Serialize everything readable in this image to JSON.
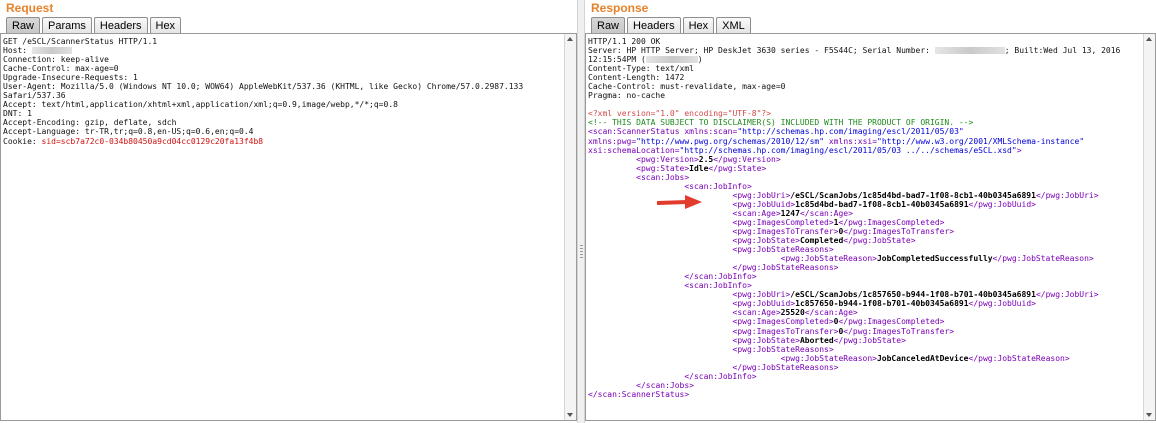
{
  "request": {
    "title": "Request",
    "tabs": [
      "Raw",
      "Params",
      "Headers",
      "Hex"
    ],
    "lines": [
      "GET /eSCL/ScannerStatus HTTP/1.1",
      "Host: ",
      "Connection: keep-alive",
      "Cache-Control: max-age=0",
      "Upgrade-Insecure-Requests: 1",
      "User-Agent: Mozilla/5.0 (Windows NT 10.0; WOW64) AppleWebKit/537.36 (KHTML, like Gecko) Chrome/57.0.2987.133",
      "Safari/537.36",
      "Accept: text/html,application/xhtml+xml,application/xml;q=0.9,image/webp,*/*;q=0.8",
      "DNT: 1",
      "Accept-Encoding: gzip, deflate, sdch",
      "Accept-Language: tr-TR,tr;q=0.8,en-US;q=0.6,en;q=0.4"
    ],
    "cookie_label": "Cookie: ",
    "cookie_name": "sid",
    "cookie_value": "=scb7a72c0-034b80450a9cd04cc0129c20fa13f4b8"
  },
  "response": {
    "title": "Response",
    "tabs": [
      "Raw",
      "Headers",
      "Hex",
      "XML"
    ],
    "status_line": "HTTP/1.1 200 OK",
    "server_prefix": "Server: HP HTTP Server; HP DeskJet 3630 series - F5S44C; Serial Number: ",
    "server_suffix": "; Built:Wed Jul 13, 2016",
    "built_time_prefix": "12:15:54PM (",
    "built_time_suffix": ")",
    "headers": [
      "Content-Type: text/xml",
      "Content-Length: 1472",
      "Cache-Control: must-revalidate, max-age=0",
      "Pragma: no-cache"
    ],
    "xml_decl": "<?xml version=\"1.0\" encoding=\"UTF-8\"?>",
    "xml_comment": "<!-- THIS DATA SUBJECT TO DISCLAIMER(S) INCLUDED WITH THE PRODUCT OF ORIGIN. -->",
    "ns_scan": "http://schemas.hp.com/imaging/escl/2011/05/03",
    "ns_pwg": "http://www.pwg.org/schemas/2010/12/sm",
    "ns_xsi": "http://www.w3.org/2001/XMLSchema-instance",
    "schema_location": "http://schemas.hp.com/imaging/escl/2011/05/03 ../../schemas/eSCL.xsd",
    "version": "2.5",
    "state": "Idle",
    "jobs": [
      {
        "uri": "/eSCL/ScanJobs/1c85d4bd-bad7-1f08-8cb1-40b0345a6891",
        "uuid": "1c85d4bd-bad7-1f08-8cb1-40b0345a6891",
        "age": "1247",
        "images_completed": "1",
        "images_to_transfer": "0",
        "job_state": "Completed",
        "job_state_reason": "JobCompletedSuccessfully"
      },
      {
        "uri": "/eSCL/ScanJobs/1c857650-b944-1f08-b701-40b0345a6891",
        "uuid": "1c857650-b944-1f08-b701-40b0345a6891",
        "age": "25520",
        "images_completed": "0",
        "images_to_transfer": "0",
        "job_state": "Aborted",
        "job_state_reason": "JobCanceledAtDevice"
      }
    ]
  },
  "colors": {
    "title_orange": "#e8822a",
    "xml_tag": "#7a00b6",
    "xml_attr_value": "#0000d8",
    "xml_comment": "#1d8a1d",
    "annotation_arrow": "#e23b2e"
  }
}
